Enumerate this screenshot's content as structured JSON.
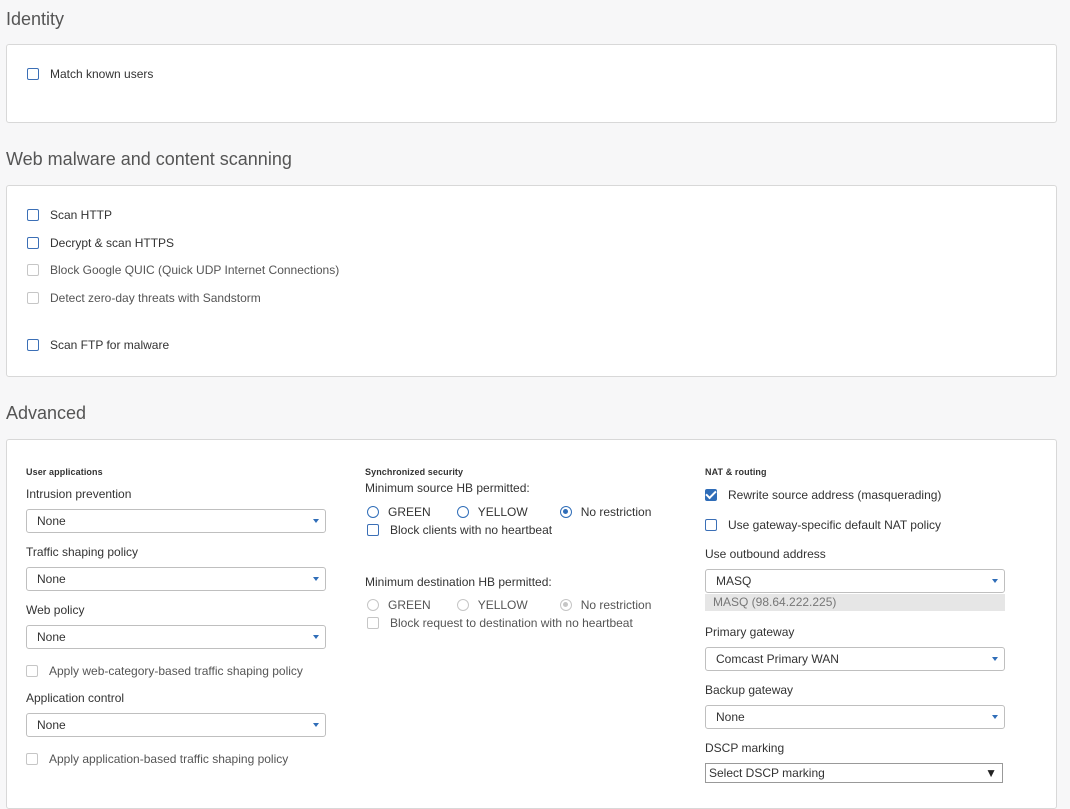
{
  "identity": {
    "title": "Identity",
    "match_known_users": "Match known users"
  },
  "web": {
    "title": "Web malware and content scanning",
    "scan_http": "Scan HTTP",
    "decrypt_https": "Decrypt & scan HTTPS",
    "block_quic": "Block Google QUIC (Quick UDP Internet Connections)",
    "sandstorm": "Detect zero-day threats with Sandstorm",
    "scan_ftp": "Scan FTP for malware"
  },
  "advanced": {
    "title": "Advanced",
    "user_apps": {
      "heading": "User applications",
      "ips_label": "Intrusion prevention",
      "ips_value": "None",
      "shaping_label": "Traffic shaping policy",
      "shaping_value": "None",
      "web_label": "Web policy",
      "web_value": "None",
      "web_shaping": "Apply web-category-based traffic shaping policy",
      "appctrl_label": "Application control",
      "appctrl_value": "None",
      "app_shaping": "Apply application-based traffic shaping policy"
    },
    "sync": {
      "heading": "Synchronized security",
      "min_source": "Minimum source HB permitted:",
      "green": "GREEN",
      "yellow": "YELLOW",
      "no_restriction": "No restriction",
      "block_clients": "Block clients with no heartbeat",
      "min_dest": "Minimum destination HB permitted:",
      "block_request": "Block request to destination with no heartbeat"
    },
    "nat": {
      "heading": "NAT & routing",
      "rewrite": "Rewrite source address (masquerading)",
      "gateway_nat": "Use gateway-specific default NAT policy",
      "outbound_label": "Use outbound address",
      "outbound_value": "MASQ",
      "outbound_hint": "MASQ (98.64.222.225)",
      "primary_label": "Primary gateway",
      "primary_value": "Comcast Primary WAN",
      "backup_label": "Backup gateway",
      "backup_value": "None",
      "dscp_label": "DSCP marking",
      "dscp_value": "Select DSCP marking"
    }
  }
}
